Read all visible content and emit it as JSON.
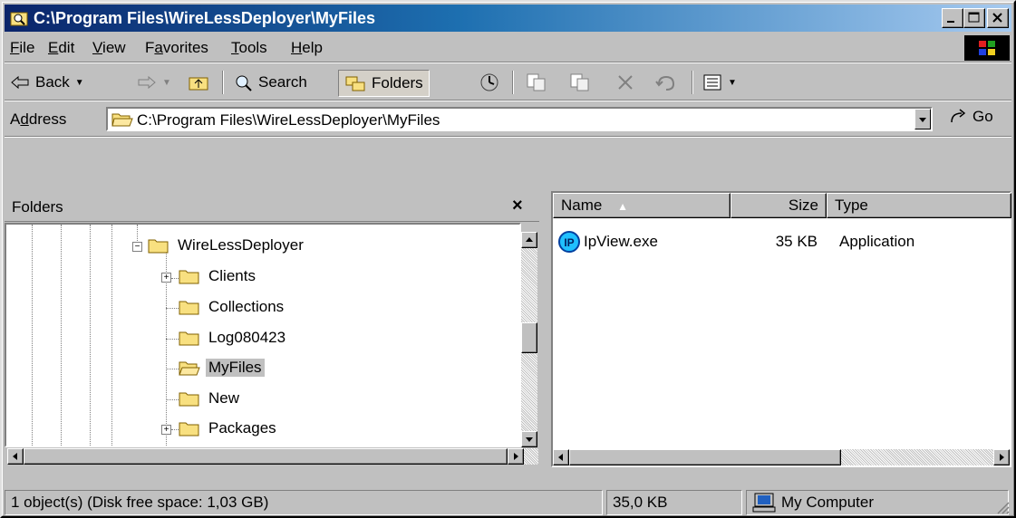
{
  "window": {
    "title": "C:\\Program Files\\WireLessDeployer\\MyFiles"
  },
  "menu": {
    "items": [
      {
        "label": "File",
        "key": "F",
        "rest": "ile"
      },
      {
        "label": "Edit",
        "key": "E",
        "rest": "dit"
      },
      {
        "label": "View",
        "key": "V",
        "rest": "iew"
      },
      {
        "label": "Favorites",
        "pre": "F",
        "key": "a",
        "rest": "vorites"
      },
      {
        "label": "Tools",
        "key": "T",
        "rest": "ools"
      },
      {
        "label": "Help",
        "key": "H",
        "rest": "elp"
      }
    ]
  },
  "toolbar": {
    "back_label": "Back",
    "search_label": "Search",
    "folders_label": "Folders"
  },
  "address": {
    "label_pre": "A",
    "label_key": "d",
    "label_rest": "dress",
    "value": "C:\\Program Files\\WireLessDeployer\\MyFiles",
    "go_label": "Go"
  },
  "folders_pane": {
    "title": "Folders",
    "close": "×",
    "items": [
      {
        "label": "WireLessDeployer",
        "expander": "−",
        "selected": false
      },
      {
        "label": "Clients",
        "expander": "+",
        "selected": false
      },
      {
        "label": "Collections",
        "expander": "",
        "selected": false
      },
      {
        "label": "Log080423",
        "expander": "",
        "selected": false
      },
      {
        "label": "MyFiles",
        "expander": "",
        "selected": true
      },
      {
        "label": "New",
        "expander": "",
        "selected": false
      },
      {
        "label": "Packages",
        "expander": "+",
        "selected": false
      }
    ]
  },
  "files_pane": {
    "columns": {
      "name": "Name",
      "size": "Size",
      "type": "Type"
    },
    "rows": [
      {
        "name": "IpView.exe",
        "size": "35 KB",
        "type": "Application",
        "icon_text": "IP"
      }
    ]
  },
  "status": {
    "objects": "1 object(s) (Disk free space: 1,03 GB)",
    "size": "35,0 KB",
    "location": "My Computer"
  },
  "colors": {
    "title_gradient_start": "#0a246a",
    "title_gradient_end": "#a6caf0",
    "face": "#c0c0c0",
    "folder_yellow": "#f8e080"
  }
}
